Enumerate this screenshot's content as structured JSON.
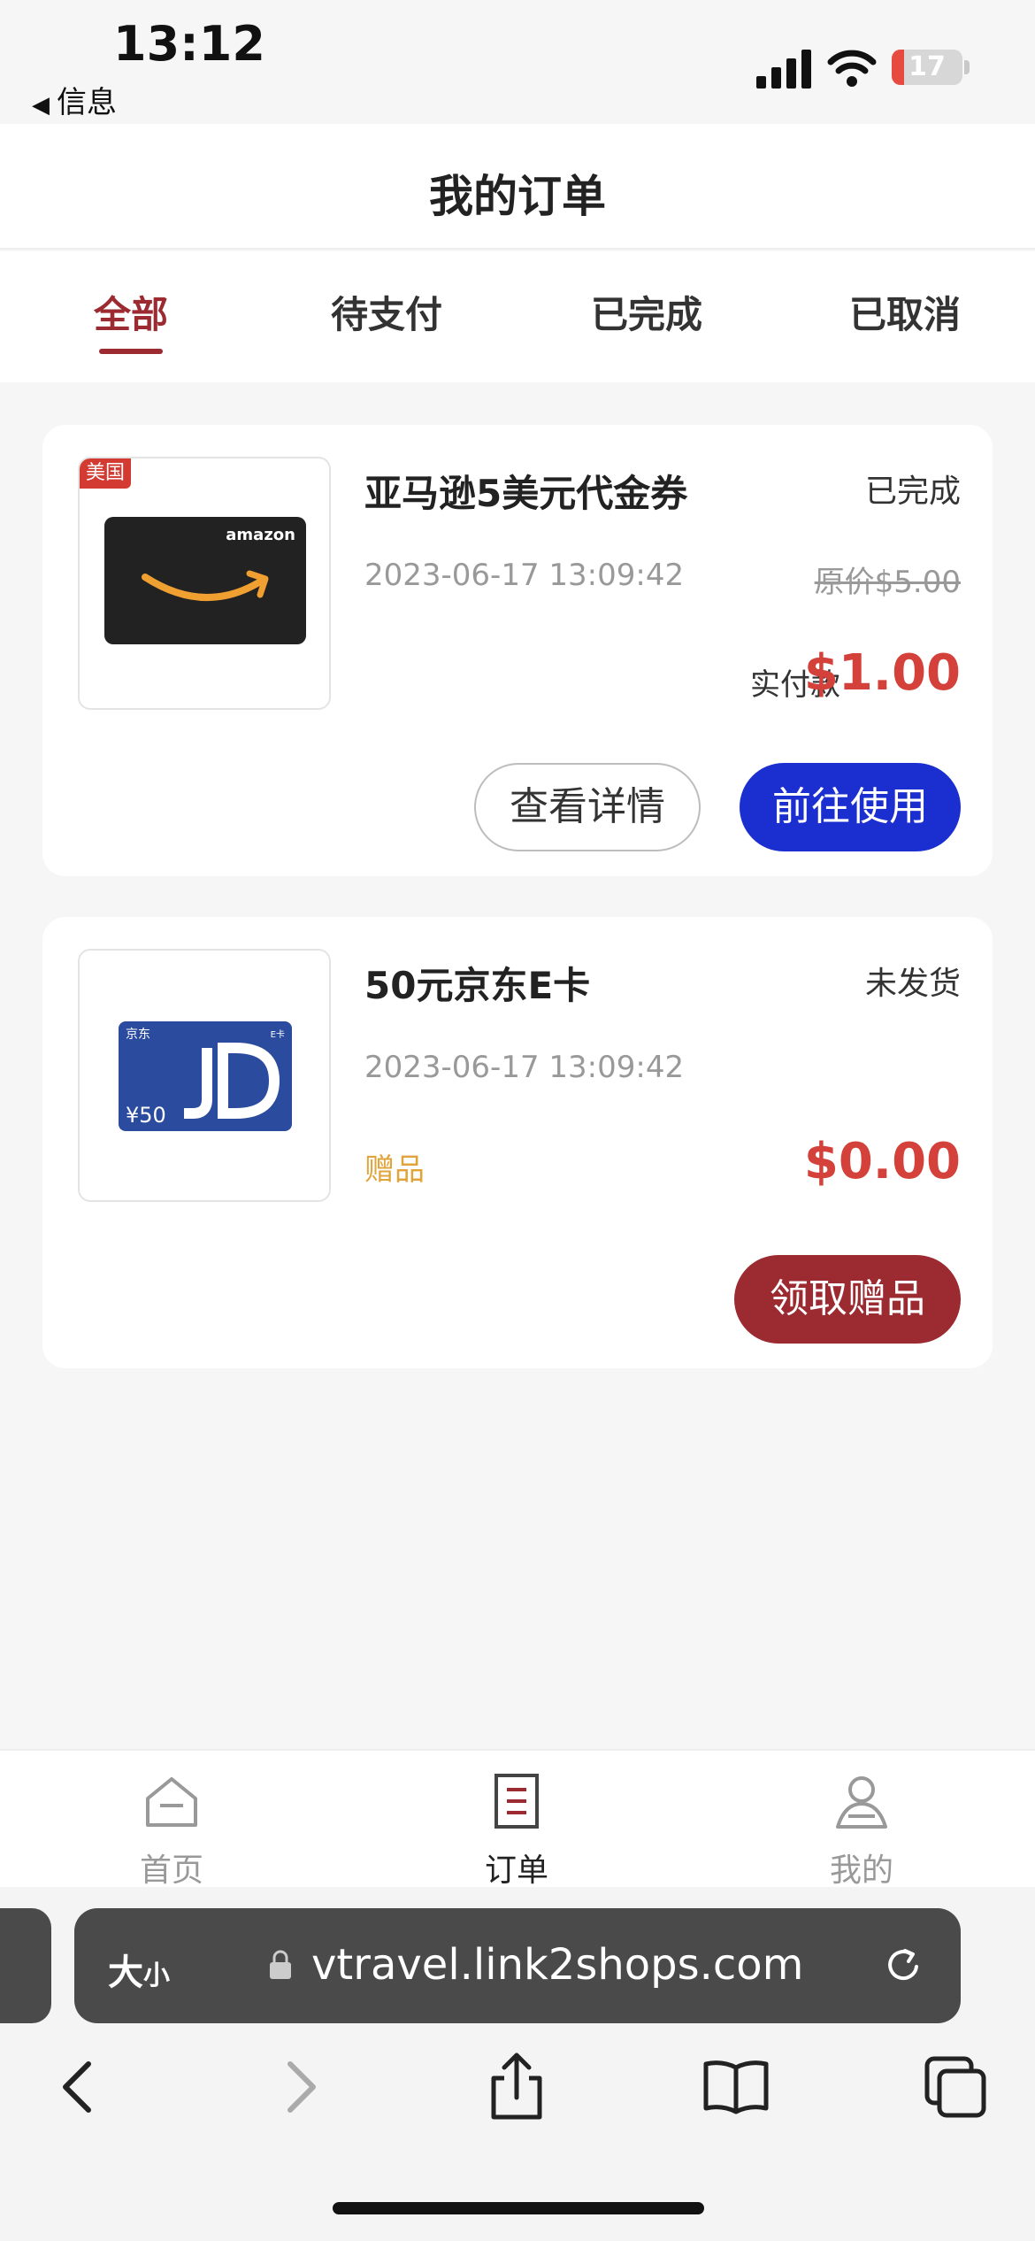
{
  "status_bar": {
    "time": "13:12",
    "back_label": "信息",
    "battery": "17",
    "battery_level": 0.17
  },
  "header": {
    "title": "我的订单"
  },
  "tabs": [
    "全部",
    "待支付",
    "已完成",
    "已取消"
  ],
  "orders": [
    {
      "title": "亚马逊5美元代金券",
      "status": "已完成",
      "date": "2023-06-17 13:09:42",
      "region_tag": "美国",
      "original_price": "原价$5.00",
      "paid_label": "实付款",
      "paid_value": "$1.00",
      "card_brand": "amazon",
      "buttons": [
        "查看详情",
        "前往使用"
      ]
    },
    {
      "title": "50元京东E卡",
      "status": "未发货",
      "date": "2023-06-17 13:09:42",
      "gift_label": "赠品",
      "paid_value": "$0.00",
      "card_value": "¥50",
      "buttons": [
        "领取赠品"
      ]
    }
  ],
  "bottom_nav": [
    {
      "label": "首页",
      "icon": "home-icon"
    },
    {
      "label": "订单",
      "icon": "order-icon"
    },
    {
      "label": "我的",
      "icon": "profile-icon"
    }
  ],
  "browser": {
    "size_label": "大",
    "size_label_small": "小",
    "url": "vtravel.link2shops.com"
  },
  "colors": {
    "accent": "#9b2a31",
    "blue_button": "#1b2fd0",
    "price": "#d3413a",
    "gift": "#e0a43a"
  }
}
